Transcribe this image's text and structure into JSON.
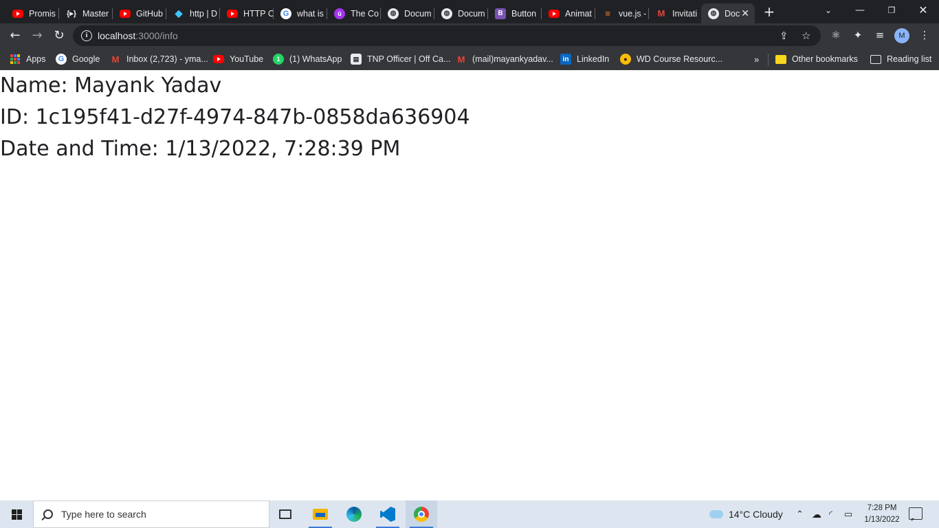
{
  "browser": {
    "tabs": [
      {
        "label": "Promis",
        "icon": "youtube-icon"
      },
      {
        "label": "Master",
        "icon": "code-icon"
      },
      {
        "label": "GitHub",
        "icon": "youtube-icon"
      },
      {
        "label": "http | D",
        "icon": "dart-icon"
      },
      {
        "label": "HTTP C",
        "icon": "youtube-icon"
      },
      {
        "label": "what is",
        "icon": "google-icon"
      },
      {
        "label": "The Co",
        "icon": "udemy-icon"
      },
      {
        "label": "Docum",
        "icon": "globe-icon"
      },
      {
        "label": "Docum",
        "icon": "globe-icon"
      },
      {
        "label": "Button",
        "icon": "bootstrap-icon"
      },
      {
        "label": "Animat",
        "icon": "youtube-icon"
      },
      {
        "label": "vue.js -",
        "icon": "stackoverflow-icon"
      },
      {
        "label": "Invitati",
        "icon": "gmail-icon"
      },
      {
        "label": "Doc",
        "icon": "globe-icon",
        "active": true
      }
    ],
    "address": {
      "host": "localhost",
      "path": ":3000/info"
    },
    "bookmarks": [
      {
        "label": "Apps",
        "icon": "apps-grid-icon"
      },
      {
        "label": "Google",
        "icon": "google-icon"
      },
      {
        "label": "Inbox (2,723) - yma...",
        "icon": "gmail-icon"
      },
      {
        "label": "YouTube",
        "icon": "youtube-icon"
      },
      {
        "label": "(1) WhatsApp",
        "icon": "whatsapp-icon"
      },
      {
        "label": "TNP Officer | Off Ca...",
        "icon": "tnp-icon"
      },
      {
        "label": "(mail)mayankyadav...",
        "icon": "gmail-icon"
      },
      {
        "label": "LinkedIn",
        "icon": "linkedin-icon"
      },
      {
        "label": "WD Course Resourc...",
        "icon": "wd-icon"
      }
    ],
    "bookmarks_overflow": "»",
    "other_bookmarks": "Other bookmarks",
    "reading_list": "Reading list",
    "profile_initial": "M"
  },
  "page": {
    "name_line": "Name: Mayank Yadav",
    "id_line": "ID: 1c195f41-d27f-4974-847b-0858da636904",
    "datetime_line": "Date and Time: 1/13/2022, 7:28:39 PM"
  },
  "taskbar": {
    "search_placeholder": "Type here to search",
    "weather": "14°C  Cloudy",
    "time": "7:28 PM",
    "date": "1/13/2022"
  },
  "colors": {
    "tab_strip_bg": "#202124",
    "toolbar_bg": "#35363a",
    "taskbar_bg": "#dde6f0"
  }
}
